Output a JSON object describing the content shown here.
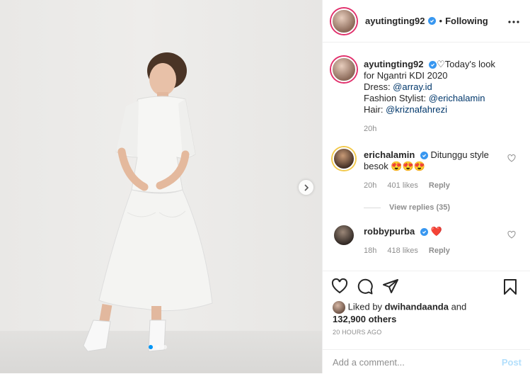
{
  "header": {
    "username": "ayutingting92",
    "separator": "•",
    "follow_status": "Following"
  },
  "caption": {
    "username": "ayutingting92",
    "heart": "♡",
    "line1": "Today's look",
    "line2": "for Ngantri KDI 2020",
    "dress_label": "Dress: ",
    "dress_mention": "@array.id",
    "stylist_label": "Fashion Stylist: ",
    "stylist_mention": "@erichalamin",
    "hair_label": "Hair: ",
    "hair_mention": "@kriznafahrezi",
    "time": "20h"
  },
  "comments": [
    {
      "username": "erichalamin",
      "text": "Ditunggu style besok",
      "emoji": "😍😍😍",
      "time": "20h",
      "likes": "401 likes",
      "reply": "Reply",
      "view_replies": "View replies (35)"
    },
    {
      "username": "robbypurba",
      "emoji": "❤️",
      "time": "18h",
      "likes": "418 likes",
      "reply": "Reply"
    }
  ],
  "likes": {
    "prefix": "Liked by ",
    "user": "dwihandaanda",
    "and": " and",
    "others": "132,900 others"
  },
  "timestamp": "20 HOURS AGO",
  "add_comment": {
    "placeholder": "Add a comment...",
    "post_label": "Post"
  },
  "colors": {
    "verified": "#3897f0",
    "link": "#00376b",
    "muted": "#8e8e8e",
    "post_disabled": "#b2dffc"
  }
}
